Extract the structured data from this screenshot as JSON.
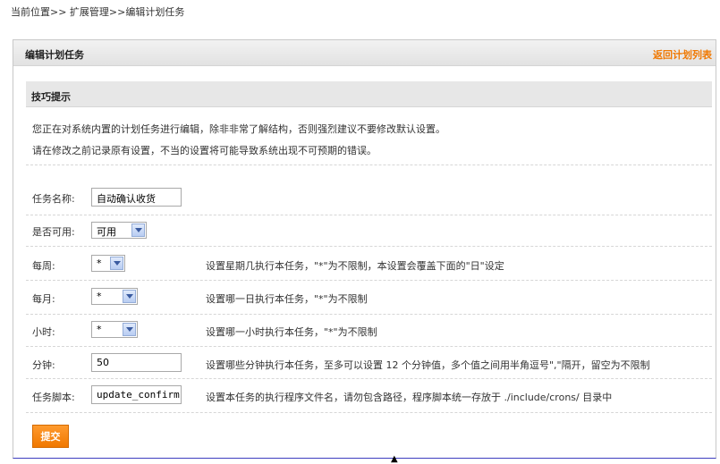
{
  "breadcrumb": "当前位置>> 扩展管理>>编辑计划任务",
  "header": {
    "title": "编辑计划任务",
    "back_link": "返回计划列表"
  },
  "tips": {
    "title": "技巧提示",
    "line1": "您正在对系统内置的计划任务进行编辑，除非非常了解结构，否则强烈建议不要修改默认设置。",
    "line2": "请在修改之前记录原有设置，不当的设置将可能导致系统出现不可预期的错误。"
  },
  "form": {
    "name": {
      "label": "任务名称:",
      "value": "自动确认收货"
    },
    "enabled": {
      "label": "是否可用:",
      "value": "可用"
    },
    "weekday": {
      "label": "每周:",
      "value": "*",
      "desc": "设置星期几执行本任务，\"*\"为不限制，本设置会覆盖下面的\"日\"设定"
    },
    "day": {
      "label": "每月:",
      "value": "*",
      "desc": "设置哪一日执行本任务，\"*\"为不限制"
    },
    "hour": {
      "label": "小时:",
      "value": "*",
      "desc": "设置哪一小时执行本任务，\"*\"为不限制"
    },
    "minute": {
      "label": "分钟:",
      "value": "50",
      "desc": "设置哪些分钟执行本任务，至多可以设置 12 个分钟值，多个值之间用半角逗号\",\"隔开，留空为不限制"
    },
    "script": {
      "label": "任务脚本:",
      "value": "update_confirm",
      "desc": "设置本任务的执行程序文件名，请勿包含路径，程序脚本统一存放于 ./include/crons/ 目录中"
    },
    "submit_label": "提交"
  }
}
